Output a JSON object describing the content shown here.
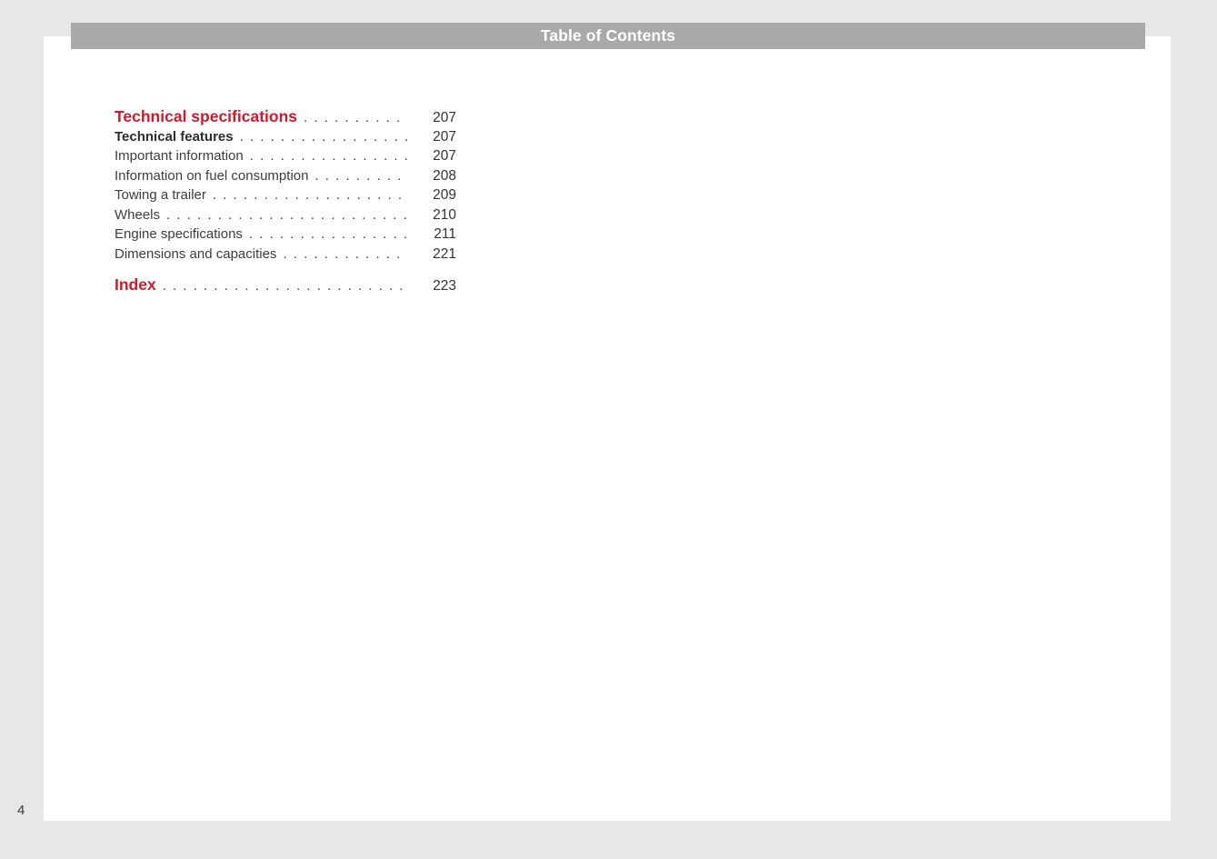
{
  "header": {
    "title": "Table of Contents"
  },
  "folio": "4",
  "toc": {
    "entries": [
      {
        "label": "Technical specifications",
        "page": "207",
        "style": "section"
      },
      {
        "label": "Technical features",
        "page": "207",
        "style": "bold"
      },
      {
        "label": "Important information",
        "page": "207",
        "style": "normal"
      },
      {
        "label": "Information on fuel consumption",
        "page": "208",
        "style": "normal"
      },
      {
        "label": "Towing a trailer",
        "page": "209",
        "style": "normal"
      },
      {
        "label": "Wheels",
        "page": "210",
        "style": "normal"
      },
      {
        "label": "Engine specifications",
        "page": "211",
        "style": "normal"
      },
      {
        "label": "Dimensions and capacities",
        "page": "221",
        "style": "normal"
      },
      {
        "label": "Index",
        "page": "223",
        "style": "section",
        "gap_before": true
      }
    ]
  },
  "colors": {
    "accent_red": "#cb1b2c",
    "header_bar_gray": "#a9a9a9",
    "canvas_background": "#e7e7e9",
    "body_text": "#3c3c3c"
  }
}
